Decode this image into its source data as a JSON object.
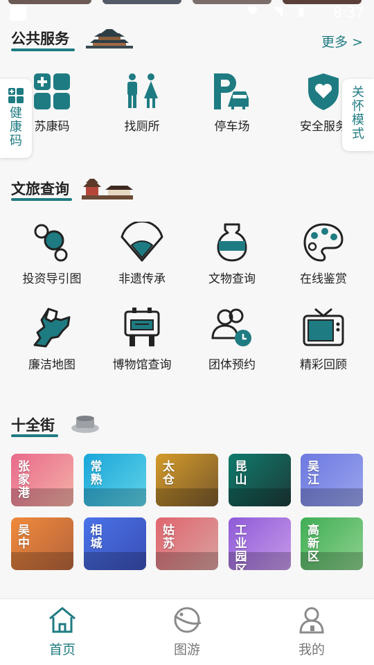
{
  "status_bar": {
    "time": "8:37"
  },
  "public_services": {
    "title": "公共服务",
    "more": "更多 >",
    "items": [
      {
        "label": "苏康码",
        "icon": "health-code-icon"
      },
      {
        "label": "找厕所",
        "icon": "restroom-icon"
      },
      {
        "label": "停车场",
        "icon": "parking-icon"
      },
      {
        "label": "安全服务",
        "icon": "shield-heart-icon"
      }
    ]
  },
  "side_tabs": {
    "left": {
      "label": "健康码"
    },
    "right": {
      "label": "关怀模式"
    }
  },
  "culture_query": {
    "title": "文旅查询",
    "items": [
      {
        "label": "投资导引图",
        "icon": "investment-map-icon"
      },
      {
        "label": "非遗传承",
        "icon": "fan-icon"
      },
      {
        "label": "文物查询",
        "icon": "vase-icon"
      },
      {
        "label": "在线鉴赏",
        "icon": "palette-icon"
      },
      {
        "label": "廉洁地图",
        "icon": "region-map-icon"
      },
      {
        "label": "博物馆查询",
        "icon": "museum-icon"
      },
      {
        "label": "团体预约",
        "icon": "group-booking-icon"
      },
      {
        "label": "精彩回顾",
        "icon": "tv-icon"
      }
    ]
  },
  "ten_streets": {
    "title": "十全街",
    "tiles": [
      {
        "name": "张家港",
        "color_a": "#e96a8c",
        "color_b": "#f4b1a6"
      },
      {
        "name": "常熟",
        "color_a": "#1aa6d9",
        "color_b": "#5fd3e8"
      },
      {
        "name": "太仓",
        "color_a": "#d49b2a",
        "color_b": "#7a5a2c"
      },
      {
        "name": "昆山",
        "color_a": "#0e7b6c",
        "color_b": "#1d3b3a"
      },
      {
        "name": "吴江",
        "color_a": "#6d79e0",
        "color_b": "#9aa5ee"
      },
      {
        "name": "吴中",
        "color_a": "#f08a3c",
        "color_b": "#b5643c"
      },
      {
        "name": "相城",
        "color_a": "#4a72e8",
        "color_b": "#3a4fb7"
      },
      {
        "name": "姑苏",
        "color_a": "#e0656e",
        "color_b": "#d9a2a0"
      },
      {
        "name": "工业园区",
        "color_a": "#8f5ad8",
        "color_b": "#c69ae8"
      },
      {
        "name": "高新区",
        "color_a": "#3fae55",
        "color_b": "#8ed18e"
      }
    ]
  },
  "bottom_nav": [
    {
      "label": "首页",
      "icon": "home-icon",
      "active": true
    },
    {
      "label": "图游",
      "icon": "planet-icon",
      "active": false
    },
    {
      "label": "我的",
      "icon": "profile-icon",
      "active": false
    }
  ],
  "colors": {
    "accent": "#1f7b82",
    "text": "#222222",
    "muted": "#777777"
  }
}
